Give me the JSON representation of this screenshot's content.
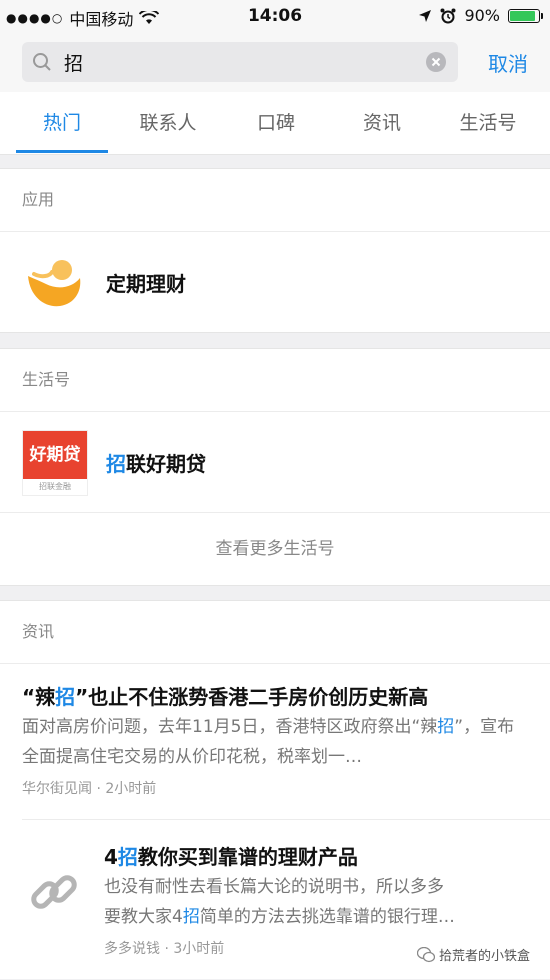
{
  "status_bar": {
    "carrier": "中国移动",
    "time": "14:06",
    "battery_percent_label": "90%",
    "battery_level": 0.9
  },
  "search": {
    "query": "招",
    "cancel_label": "取消"
  },
  "tabs": [
    {
      "label": "热门",
      "active": true
    },
    {
      "label": "联系人",
      "active": false
    },
    {
      "label": "口碑",
      "active": false
    },
    {
      "label": "资讯",
      "active": false
    },
    {
      "label": "生活号",
      "active": false
    }
  ],
  "apps_section": {
    "header": "应用",
    "items": [
      {
        "name": "定期理财",
        "icon": "yellow-smile-icon"
      }
    ]
  },
  "life_section": {
    "header": "生活号",
    "items": [
      {
        "highlight": "招",
        "rest": "联好期贷",
        "icon_text": "好期贷",
        "icon_sub": "招联金融"
      }
    ],
    "more_label": "查看更多生活号"
  },
  "news_section": {
    "header": "资讯",
    "items": [
      {
        "title_pre": "“辣",
        "title_hl": "招",
        "title_post": "”也止不住涨势香港二手房价创历史新高",
        "desc_pre": "面对高房价问题，去年11月5日，香港特区政府祭出“辣",
        "desc_hl": "招",
        "desc_post": "”，宣布全面提高住宅交易的从价印花税，税率划一…",
        "source": "华尔街见闻",
        "time": "2小时前"
      },
      {
        "title_pre": "4",
        "title_hl": "招",
        "title_post": "教你买到靠谱的理财产品",
        "desc_line1": "也没有耐性去看长篇大论的说明书，所以多多",
        "desc_line2_pre": "要教大家4",
        "desc_line2_hl": "招",
        "desc_line2_post": "简单的方法去挑选靠谱的银行理…",
        "source": "多多说钱",
        "time": "3小时前",
        "icon": "link-icon"
      }
    ]
  },
  "watermark": "拾荒者的小铁盒",
  "colors": {
    "accent": "#1e88e5",
    "battery": "#34c759"
  }
}
